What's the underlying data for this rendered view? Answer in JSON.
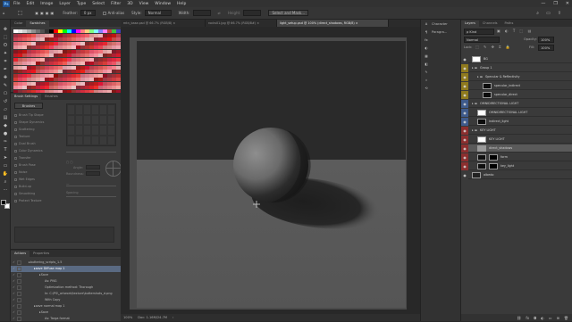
{
  "app": {
    "logo": "Ps"
  },
  "menu": [
    "File",
    "Edit",
    "Image",
    "Layer",
    "Type",
    "Select",
    "Filter",
    "3D",
    "View",
    "Window",
    "Help"
  ],
  "window_controls": [
    "—",
    "❐",
    "✕"
  ],
  "options_bar": {
    "feather_label": "Feather:",
    "feather_value": "0 px",
    "antialias_label": "Anti-alias",
    "style_label": "Style:",
    "style_value": "Normal",
    "width_label": "Width:",
    "height_label": "Height:",
    "select_mask_button": "Select and Mask..."
  },
  "doc_tabs": [
    {
      "label": "mtn_base.psd @ 66.7% (RGB/8) ×",
      "active": false
    },
    {
      "label": "rocks01.jpg @ 66.7% (RGB/8#) ×",
      "active": false
    },
    {
      "label": "light_setup.psd @ 100% (direct_shadows, RGB/8) ×",
      "active": true
    }
  ],
  "swatches_panel": {
    "tabs": [
      "Color",
      "Swatches"
    ],
    "active_tab": 1
  },
  "brush_panel": {
    "tabs": [
      "Brush Settings",
      "Brushes"
    ],
    "brushes_button": "Brushes",
    "options": [
      "Brush Tip Shape",
      "Shape Dynamics",
      "Scattering",
      "Texture",
      "Dual Brush",
      "Color Dynamics",
      "Transfer",
      "Brush Pose",
      "Noise",
      "Wet Edges",
      "Build-up",
      "Smoothing",
      "Protect Texture"
    ],
    "angle_label": "Angle:",
    "roundness_label": "Roundness:",
    "spacing_label": "Spacing"
  },
  "actions_panel": {
    "tabs": [
      "Actions",
      "Properties"
    ],
    "rows": [
      {
        "text": "buttering_scripts_1.5",
        "indent": 1,
        "selected": false
      },
      {
        "text": "save Diffuse map 1",
        "indent": 2,
        "selected": true
      },
      {
        "text": "Save",
        "indent": 3,
        "selected": false
      },
      {
        "text": "As: PNG",
        "indent": 4,
        "selected": false
      },
      {
        "text": "Optimization method: Thorough",
        "indent": 4,
        "selected": false
      },
      {
        "text": "In: C:\\PS\\_artwork\\texture\\buttershots_d.png",
        "indent": 4,
        "selected": false
      },
      {
        "text": "With Copy",
        "indent": 4,
        "selected": false
      },
      {
        "text": "save normal map 1",
        "indent": 2,
        "selected": false
      },
      {
        "text": "Save",
        "indent": 3,
        "selected": false
      },
      {
        "text": "As: Targa format",
        "indent": 4,
        "selected": false
      }
    ]
  },
  "statusbar": {
    "zoom": "100%",
    "doc": "Doc: 1.16M/24.7M",
    "arrow": "›"
  },
  "dock": [
    {
      "icon": "A",
      "label": "Character"
    },
    {
      "icon": "¶",
      "label": "Paragra..."
    },
    {
      "icon": "fx",
      "label": ""
    },
    {
      "icon": "◐",
      "label": ""
    },
    {
      "icon": "▦",
      "label": ""
    },
    {
      "icon": "◧",
      "label": ""
    },
    {
      "icon": "✎",
      "label": ""
    },
    {
      "icon": "⌗",
      "label": ""
    },
    {
      "icon": "⟲",
      "label": ""
    }
  ],
  "layers_panel": {
    "tabs": [
      "Layers",
      "Channels",
      "Paths"
    ],
    "kind_value": "ρ Kind",
    "blend_value": "Normal",
    "opacity_label": "Opacity:",
    "opacity_value": "100%",
    "lock_label": "Lock:",
    "fill_label": "Fill:",
    "fill_value": "100%",
    "rows": [
      {
        "name": "BG",
        "indent": 0,
        "color": "#3a3a3a",
        "thumb": "#ffffff",
        "folder": false,
        "mask": false,
        "selected": false
      },
      {
        "name": "Group 1",
        "indent": 0,
        "color": "#8f7a1e",
        "thumb": "",
        "folder": true,
        "mask": false,
        "selected": false
      },
      {
        "name": "Specular & Reflectivity",
        "indent": 1,
        "color": "#8f7a1e",
        "thumb": "",
        "folder": true,
        "mask": false,
        "selected": false
      },
      {
        "name": "specular_indirect",
        "indent": 2,
        "color": "#8f7a1e",
        "thumb": "#0c0c0c",
        "folder": false,
        "mask": false,
        "selected": false
      },
      {
        "name": "specular_direct",
        "indent": 2,
        "color": "#8f7a1e",
        "thumb": "#0c0c0c",
        "folder": false,
        "mask": false,
        "selected": false
      },
      {
        "name": "OMNIDIRECTIONAL LIGHT",
        "indent": 0,
        "color": "#3f5b8c",
        "thumb": "",
        "folder": true,
        "mask": false,
        "selected": false
      },
      {
        "name": "OMNIDIRECTIONAL LIGHT",
        "indent": 1,
        "color": "#3f5b8c",
        "thumb": "#ffffff",
        "folder": false,
        "mask": false,
        "selected": false
      },
      {
        "name": "indirect_light",
        "indent": 1,
        "color": "#3f5b8c",
        "thumb": "#0c0c0c",
        "folder": false,
        "mask": false,
        "selected": false
      },
      {
        "name": "KEY LIGHT",
        "indent": 0,
        "color": "#8c2f2f",
        "thumb": "",
        "folder": true,
        "mask": false,
        "selected": false
      },
      {
        "name": "KEY LIGHT",
        "indent": 1,
        "color": "#8c2f2f",
        "thumb": "#ffffff",
        "folder": false,
        "mask": false,
        "selected": false
      },
      {
        "name": "direct_shadows",
        "indent": 1,
        "color": "#8c2f2f",
        "thumb": "#9a9a9a",
        "folder": false,
        "mask": false,
        "selected": true
      },
      {
        "name": "form",
        "indent": 1,
        "color": "#8c2f2f",
        "thumb": "#101010",
        "folder": false,
        "mask": true,
        "selected": false
      },
      {
        "name": "key_light",
        "indent": 1,
        "color": "#8c2f2f",
        "thumb": "#101010",
        "folder": false,
        "mask": true,
        "selected": false
      },
      {
        "name": "albedo",
        "indent": 0,
        "color": "#3a3a3a",
        "thumb": "#222222",
        "folder": false,
        "mask": false,
        "selected": false
      }
    ],
    "footer_icons": [
      "⛓",
      "fx",
      "◘",
      "◐",
      "▭",
      "⊞",
      "🗑"
    ]
  },
  "colors": {
    "canvas_top": "#2a2a2a",
    "canvas_floor": "#595959",
    "ball_light": "#8a8a8a",
    "ball_dark": "#1c1c1c",
    "shadow": "#232323"
  }
}
